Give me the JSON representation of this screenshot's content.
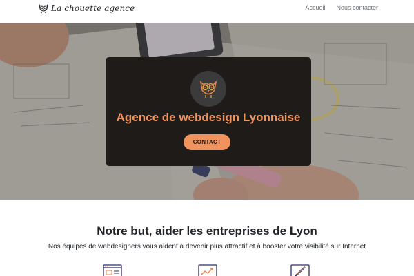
{
  "navbar": {
    "brand_name": "La chouette agence",
    "links": [
      {
        "label": "Accueil"
      },
      {
        "label": "Nous contacter"
      }
    ]
  },
  "hero": {
    "title": "Agence de webdesign Lyonnaise",
    "cta_label": "CONTACT"
  },
  "about": {
    "title": "Notre but, aider les entreprises de Lyon",
    "subtitle": "Nos équipes de webdesigners vous aident à devenir plus attractif et à booster votre visibilité sur Internet"
  },
  "features": [
    {
      "icon": "web-layout-icon"
    },
    {
      "icon": "growth-chart-icon"
    },
    {
      "icon": "design-pencil-icon"
    }
  ],
  "colors": {
    "accent": "#f0935c",
    "card_bg": "#1e1b19",
    "text": "#212529",
    "nav_link": "#6c757d"
  }
}
